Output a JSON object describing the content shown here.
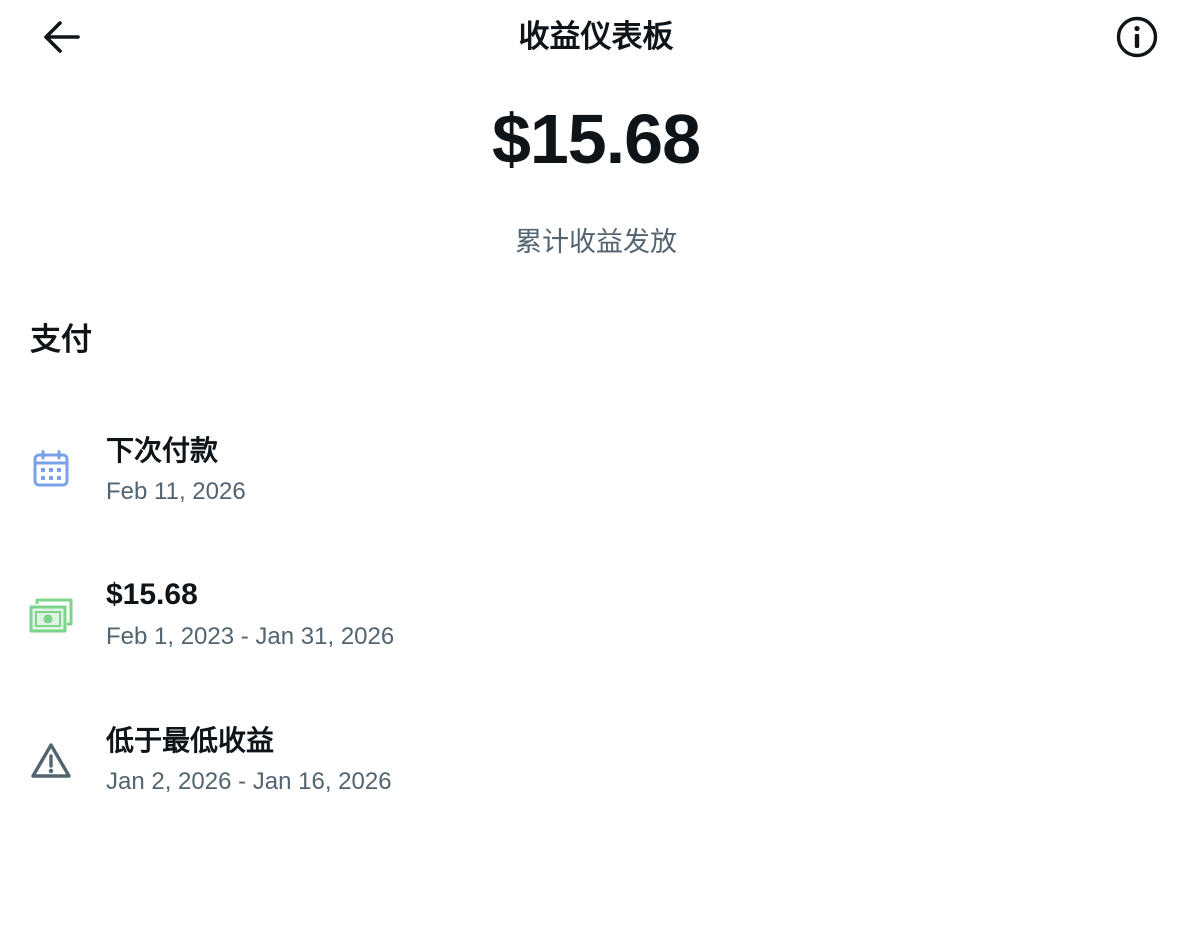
{
  "header": {
    "title": "收益仪表板",
    "back_icon": "arrow-left-icon",
    "info_icon": "info-circle-icon"
  },
  "summary": {
    "total_amount": "$15.68",
    "caption": "累计收益发放"
  },
  "payments": {
    "section_title": "支付",
    "items": [
      {
        "icon": "calendar-icon",
        "icon_color": "#7aa2e8",
        "title": "下次付款",
        "subtitle": "Feb 11, 2026"
      },
      {
        "icon": "money-bill-icon",
        "icon_color": "#7ed48b",
        "title": "$15.68",
        "subtitle": "Feb 1, 2023 - Jan 31, 2026"
      },
      {
        "icon": "warning-triangle-icon",
        "icon_color": "#536471",
        "title": "低于最低收益",
        "subtitle": "Jan 2, 2026 - Jan 16, 2026"
      }
    ]
  }
}
